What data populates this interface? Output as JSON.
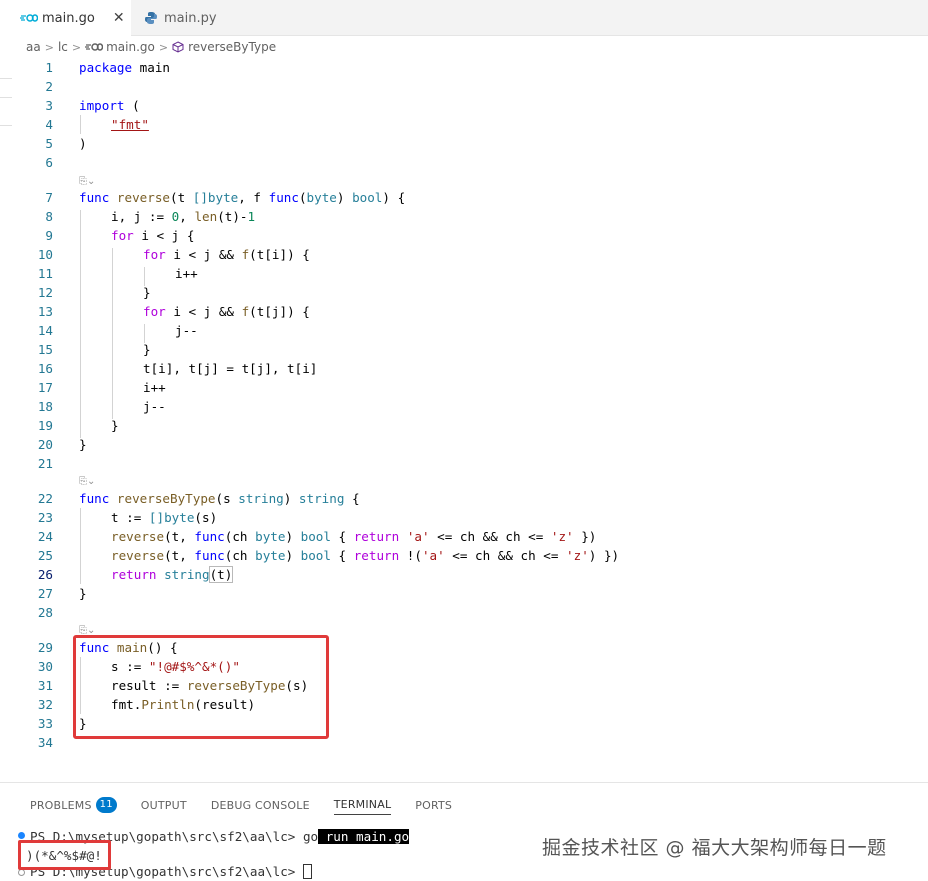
{
  "tabs": [
    {
      "label": "main.go",
      "icon": "go-file-icon",
      "active": true,
      "close": "✕"
    },
    {
      "label": "main.py",
      "icon": "python-file-icon",
      "active": false
    }
  ],
  "breadcrumb": [
    "aa",
    "lc",
    "main.go",
    "reverseByType"
  ],
  "editor": {
    "line_numbers": [
      "1",
      "2",
      "3",
      "4",
      "5",
      "6",
      "7",
      "8",
      "9",
      "10",
      "11",
      "12",
      "13",
      "14",
      "15",
      "16",
      "17",
      "18",
      "19",
      "20",
      "21",
      "22",
      "23",
      "24",
      "25",
      "26",
      "27",
      "28",
      "29",
      "30",
      "31",
      "32",
      "33",
      "34"
    ],
    "current_line": "26",
    "codelens_marker": "⎘⌄",
    "code": {
      "l1": [
        "package",
        " main"
      ],
      "l3": [
        "import",
        " ("
      ],
      "l4": "\"fmt\"",
      "l5": ")",
      "l7": [
        "func",
        " reverse",
        "(t ",
        "[]byte",
        ", f ",
        "func",
        "(",
        "byte",
        ") ",
        "bool",
        ") {"
      ],
      "l8": [
        "i, j := ",
        "0",
        ", ",
        "len",
        "(t)-",
        "1"
      ],
      "l9": [
        "for",
        " i < j {"
      ],
      "l10": [
        "for",
        " i < j && ",
        "f",
        "(t[i]) {"
      ],
      "l11": "i++",
      "l12": "}",
      "l13": [
        "for",
        " i < j && ",
        "f",
        "(t[j]) {"
      ],
      "l14": "j--",
      "l15": "}",
      "l16": "t[i], t[j] = t[j], t[i]",
      "l17": "i++",
      "l18": "j--",
      "l19": "}",
      "l20": "}",
      "l22": [
        "func",
        " reverseByType",
        "(s ",
        "string",
        ") ",
        "string",
        " {"
      ],
      "l23": [
        "t := ",
        "[]byte",
        "(s)"
      ],
      "l24": [
        "reverse",
        "(t, ",
        "func",
        "(ch ",
        "byte",
        ") ",
        "bool",
        " { ",
        "return",
        " ",
        "'a'",
        " <= ch && ch <= ",
        "'z'",
        " })"
      ],
      "l25": [
        "reverse",
        "(t, ",
        "func",
        "(ch ",
        "byte",
        ") ",
        "bool",
        " { ",
        "return",
        " !(",
        "'a'",
        " <= ch && ch <= ",
        "'z'",
        ") })"
      ],
      "l26": [
        "return",
        " ",
        "string",
        "(t)"
      ],
      "l27": "}",
      "l29": [
        "func",
        " main",
        "() {"
      ],
      "l30": [
        "s := ",
        "\"!@#$%^&*()\""
      ],
      "l31": [
        "result := ",
        "reverseByType",
        "(s)"
      ],
      "l32": [
        "fmt.",
        "Println",
        "(result)"
      ],
      "l33": "}"
    }
  },
  "panel": {
    "tabs": [
      "PROBLEMS",
      "OUTPUT",
      "DEBUG CONSOLE",
      "TERMINAL",
      "PORTS"
    ],
    "problems_count": "11",
    "active_tab": "TERMINAL"
  },
  "terminal": {
    "prompt1": "PS D:\\mysetup\\gopath\\src\\sf2\\aa\\lc> ",
    "cmd_go": "go",
    "cmd_rest": " run main.go",
    "output": ")(*&^%$#@!",
    "prompt2": "PS D:\\mysetup\\gopath\\src\\sf2\\aa\\lc> "
  },
  "watermark": "掘金技术社区 @ 福大大架构师每日一题",
  "colors": {
    "accent": "#007acc",
    "highlight_border": "#e03a3a",
    "keyword": "#0000ff",
    "string": "#a31515",
    "function": "#795e26",
    "type": "#267f99",
    "number": "#098658"
  }
}
